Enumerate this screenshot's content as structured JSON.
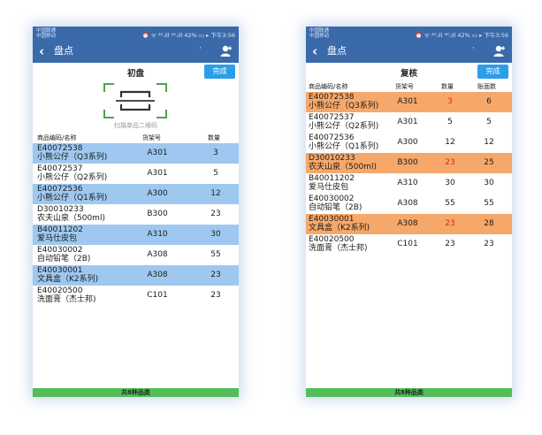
{
  "status_bar": {
    "carrier_1": "中国联通",
    "carrier_2": "中国移动",
    "right": "⏰ ᯤ ⁴⁶.ıll ⁴⁶.ıll 42% ▭ ▸ 下午3:56"
  },
  "nav": {
    "title": "盘点",
    "back_icon": "chevron-left-icon",
    "user_icon": "user-icon"
  },
  "colors": {
    "navbar": "#3b6aab",
    "highlight_blue": "#9ec8f0",
    "highlight_orange": "#f6a86a",
    "button": "#2c9ee8",
    "footer": "#53bd5a",
    "mismatch": "#e02020"
  },
  "screen1": {
    "subtitle": "初盘",
    "done_label": "完成",
    "scan_label": "扫描单品二维码",
    "headers": {
      "code": "商品编码/名称",
      "shelf": "货架号",
      "qty": "数量"
    },
    "rows": [
      {
        "code": "E40072538",
        "name": "小熊公仔（Q3系列)",
        "shelf": "A301",
        "qty": "3",
        "highlight": "blue"
      },
      {
        "code": "E40072537",
        "name": "小熊公仔（Q2系列)",
        "shelf": "A301",
        "qty": "5",
        "highlight": "none"
      },
      {
        "code": "E40072536",
        "name": "小熊公仔（Q1系列)",
        "shelf": "A300",
        "qty": "12",
        "highlight": "blue"
      },
      {
        "code": "D30010233",
        "name": "农夫山泉（500ml)",
        "shelf": "B300",
        "qty": "23",
        "highlight": "none"
      },
      {
        "code": "B40011202",
        "name": "爱马仕皮包",
        "shelf": "A310",
        "qty": "30",
        "highlight": "blue"
      },
      {
        "code": "E40030002",
        "name": "自动铅笔（2B)",
        "shelf": "A308",
        "qty": "55",
        "highlight": "none"
      },
      {
        "code": "E40030001",
        "name": "文具盒（K2系列)",
        "shelf": "A308",
        "qty": "23",
        "highlight": "blue"
      },
      {
        "code": "E40020500",
        "name": "洗面膏（杰士邦)",
        "shelf": "C101",
        "qty": "23",
        "highlight": "none"
      }
    ],
    "footer": "共8种品类"
  },
  "screen2": {
    "subtitle": "复核",
    "done_label": "完成",
    "headers": {
      "code": "商品编码/名称",
      "shelf": "货架号",
      "qty": "数量",
      "book": "账面数"
    },
    "rows": [
      {
        "code": "E40072538",
        "name": "小熊公仔（Q3系列)",
        "shelf": "A301",
        "qty": "3",
        "book": "6",
        "highlight": "orange",
        "mismatch": true
      },
      {
        "code": "E40072537",
        "name": "小熊公仔（Q2系列)",
        "shelf": "A301",
        "qty": "5",
        "book": "5",
        "highlight": "none",
        "mismatch": false
      },
      {
        "code": "E40072536",
        "name": "小熊公仔（Q1系列)",
        "shelf": "A300",
        "qty": "12",
        "book": "12",
        "highlight": "none",
        "mismatch": false
      },
      {
        "code": "D30010233",
        "name": "农夫山泉（500ml)",
        "shelf": "B300",
        "qty": "23",
        "book": "25",
        "highlight": "orange",
        "mismatch": true
      },
      {
        "code": "B40011202",
        "name": "爱马仕皮包",
        "shelf": "A310",
        "qty": "30",
        "book": "30",
        "highlight": "none",
        "mismatch": false
      },
      {
        "code": "E40030002",
        "name": "自动铅笔（2B)",
        "shelf": "A308",
        "qty": "55",
        "book": "55",
        "highlight": "none",
        "mismatch": false
      },
      {
        "code": "E40030001",
        "name": "文具盒（K2系列)",
        "shelf": "A308",
        "qty": "23",
        "book": "28",
        "highlight": "orange",
        "mismatch": true
      },
      {
        "code": "E40020500",
        "name": "洗面膏（杰士邦)",
        "shelf": "C101",
        "qty": "23",
        "book": "23",
        "highlight": "none",
        "mismatch": false
      }
    ],
    "footer": "共8种品类"
  }
}
